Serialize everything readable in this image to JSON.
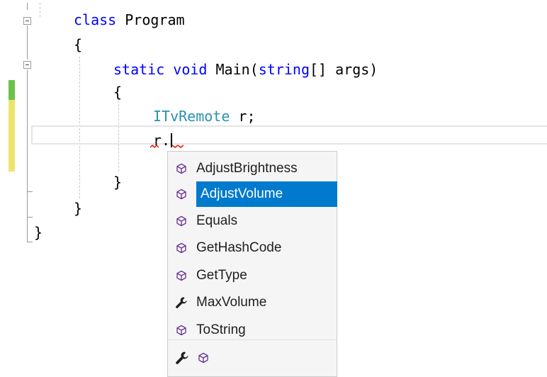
{
  "code": {
    "line1": {
      "keyword": "class",
      "name": "Program"
    },
    "line2": {
      "text": "{"
    },
    "line3": {
      "kw_static": "static",
      "kw_void": "void",
      "method": "Main",
      "open": "(",
      "kw_string": "string",
      "rest": "[] args)"
    },
    "line4": {
      "text": "{"
    },
    "line5": {
      "type": "ITvRemote",
      "rest": "r;"
    },
    "line6": {
      "text": "r."
    },
    "line7": {
      "text": "}"
    },
    "line8": {
      "text": "}"
    },
    "line9": {
      "text": "}"
    }
  },
  "completion": {
    "items": [
      {
        "label": "AdjustBrightness",
        "icon": "method-cube-icon"
      },
      {
        "label": "AdjustVolume",
        "icon": "method-cube-icon",
        "selected": true
      },
      {
        "label": "Equals",
        "icon": "method-cube-icon"
      },
      {
        "label": "GetHashCode",
        "icon": "method-cube-icon"
      },
      {
        "label": "GetType",
        "icon": "method-cube-icon"
      },
      {
        "label": "MaxVolume",
        "icon": "wrench-icon"
      },
      {
        "label": "ToString",
        "icon": "method-cube-icon"
      }
    ],
    "filters": [
      {
        "icon": "wrench-icon"
      },
      {
        "icon": "method-cube-icon"
      }
    ]
  },
  "colors": {
    "keyword": "#0000ff",
    "type": "#2b91af",
    "selection": "#007acc",
    "change_saved": "#6cc24a",
    "change_unsaved": "#efe46a",
    "method_icon": "#652d90"
  }
}
